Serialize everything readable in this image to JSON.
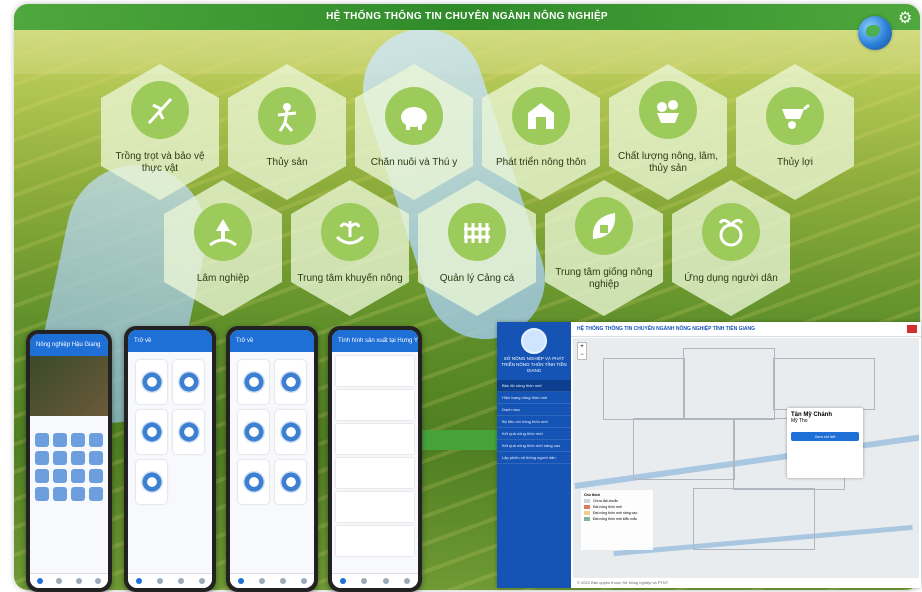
{
  "header": {
    "title": "HỆ THỐNG THÔNG TIN CHUYÊN NGÀNH NÔNG NGHIỆP"
  },
  "tiles": [
    {
      "label": "Trồng trọt và bảo vệ thực vật",
      "icon": "plant-protection-icon"
    },
    {
      "label": "Thủy sản",
      "icon": "fishing-icon"
    },
    {
      "label": "Chăn nuôi và Thú y",
      "icon": "pig-icon"
    },
    {
      "label": "Phát triển nông thôn",
      "icon": "barn-icon"
    },
    {
      "label": "Chất lượng nông, lâm, thủy sản",
      "icon": "fruit-basket-icon"
    },
    {
      "label": "Thủy lợi",
      "icon": "wheelbarrow-icon"
    },
    {
      "label": "Lâm nghiệp",
      "icon": "tree-icon"
    },
    {
      "label": "Trung tâm khuyến nông",
      "icon": "hands-plant-icon"
    },
    {
      "label": "Quản lý Cảng cá",
      "icon": "fence-icon"
    },
    {
      "label": "Trung tâm giống nông nghiệp",
      "icon": "leaf-house-icon"
    },
    {
      "label": "Ứng dụng người dân",
      "icon": "globe-plant-icon"
    }
  ],
  "phones": [
    {
      "header": "Nông nghiệp Hậu Giang"
    },
    {
      "header": "Trở về"
    },
    {
      "header": "Trở về"
    },
    {
      "header": "Tình hình sản xuất tại Hưng Yên"
    }
  ],
  "web": {
    "header": "HỆ THỐNG THÔNG TIN CHUYÊN NGÀNH NÔNG NGHIỆP TỈNH TIỀN GIANG",
    "side_title": "SỞ NÔNG NGHIỆP VÀ PHÁT TRIỂN NÔNG THÔN TỈNH TIỀN GIANG",
    "menu": [
      "Bản đồ nông thôn mới",
      "Hiện trạng nông thôn mới",
      "Danh mục",
      "Bộ tiêu chí nông thôn mới",
      "Kết quả nông thôn mới",
      "Kết quả nông thôn mới nâng cao",
      "Lập phiếu xã thông người dân"
    ],
    "popup": {
      "title": "Tân Mỹ Chánh",
      "sub": "Mỹ Tho",
      "btn": "Xem chi tiết"
    },
    "legend": {
      "title": "Chú thích",
      "items": [
        "Chưa đạt chuẩn",
        "Đạt nông thôn mới",
        "Đạt nông thôn mới nâng cao",
        "Đạt nông thôn mới kiểu mẫu"
      ]
    },
    "footer": "© 2022 Bản quyền thuộc Sở Nông nghiệp và PTNT"
  },
  "colors": {
    "accent": "#2f8a2a",
    "web_sidebar": "#1553b5",
    "tile_bg": "#ebf6d6"
  }
}
